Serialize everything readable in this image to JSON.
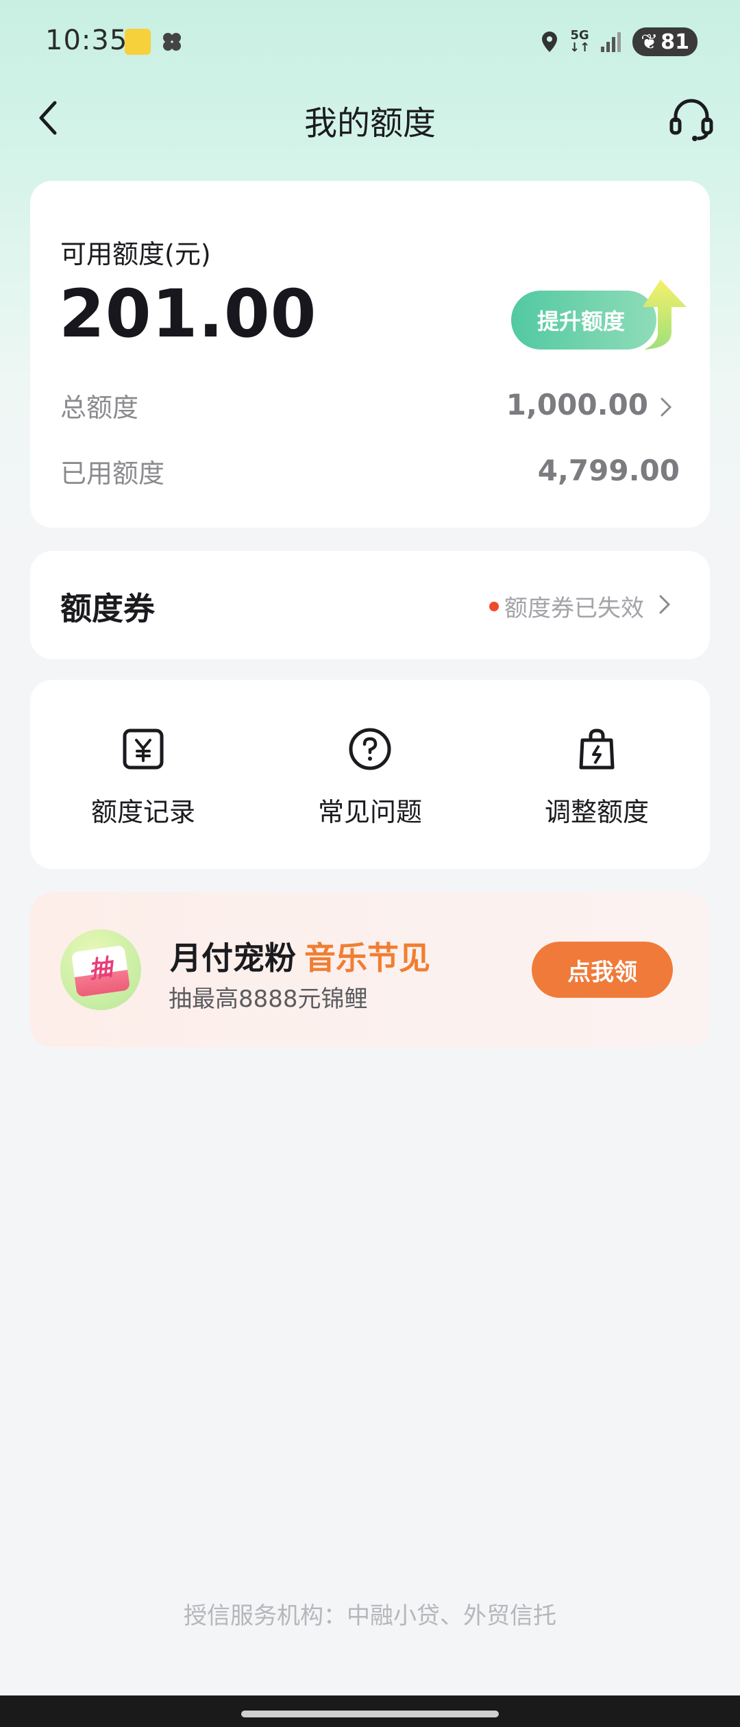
{
  "status_bar": {
    "time": "10:35",
    "network": "5G",
    "battery": "81"
  },
  "header": {
    "title": "我的额度",
    "back_icon": "chevron-left-icon",
    "service_icon": "headset-icon"
  },
  "quota": {
    "available_label": "可用额度(元)",
    "available_amount": "201.00",
    "raise_button": "提升额度",
    "total_label": "总额度",
    "total_value": "1,000.00",
    "used_label": "已用额度",
    "used_value": "4,799.00"
  },
  "coupon": {
    "title": "额度券",
    "status": "额度券已失效"
  },
  "actions": [
    {
      "label": "额度记录",
      "icon": "yuan-receipt-icon"
    },
    {
      "label": "常见问题",
      "icon": "question-circle-icon"
    },
    {
      "label": "调整额度",
      "icon": "lightning-bag-icon"
    }
  ],
  "promo": {
    "badge_text": "抽",
    "title": "月付宠粉",
    "title_accent": "音乐节见",
    "subtitle": "抽最高8888元锦鲤",
    "button": "点我领"
  },
  "footer": {
    "text": "授信服务机构：中融小贷、外贸信托"
  },
  "colors": {
    "accent_green": "#52c9a2",
    "promo_orange": "#f07a3a",
    "alert_red": "#f04a2b"
  }
}
